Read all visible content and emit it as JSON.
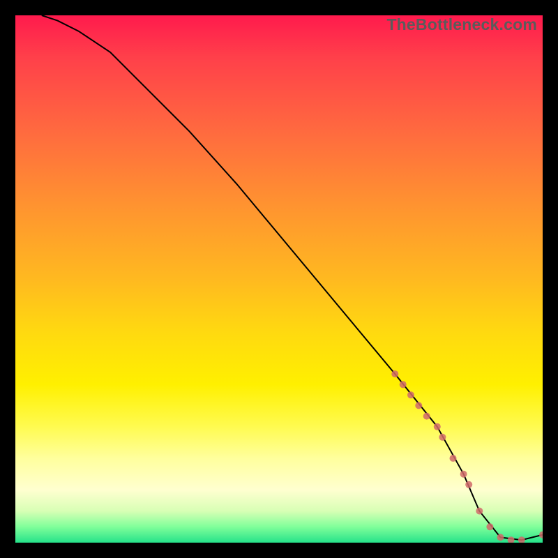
{
  "watermark": "TheBottleneck.com",
  "chart_data": {
    "type": "line",
    "title": "",
    "xlabel": "",
    "ylabel": "",
    "xlim": [
      0,
      100
    ],
    "ylim": [
      0,
      100
    ],
    "grid": false,
    "series": [
      {
        "name": "curve",
        "x": [
          5,
          8,
          12,
          18,
          25,
          33,
          42,
          52,
          62,
          72,
          80,
          85,
          88,
          92,
          96,
          100
        ],
        "y": [
          100,
          99,
          97,
          93,
          86,
          78,
          68,
          56,
          44,
          32,
          22,
          13,
          6,
          1,
          0.5,
          1.5
        ],
        "style": "line",
        "color": "#000000"
      },
      {
        "name": "highlighted-points",
        "x": [
          72,
          73.5,
          75,
          76.5,
          78,
          80,
          81,
          83,
          85,
          86,
          88,
          90,
          92,
          94,
          96,
          100
        ],
        "y": [
          32,
          30,
          28,
          26,
          24,
          22,
          20,
          16,
          13,
          11,
          6,
          3,
          1,
          0.5,
          0.5,
          1.5
        ],
        "style": "scatter",
        "color": "#d06a6a",
        "marker_size": 10
      }
    ]
  }
}
